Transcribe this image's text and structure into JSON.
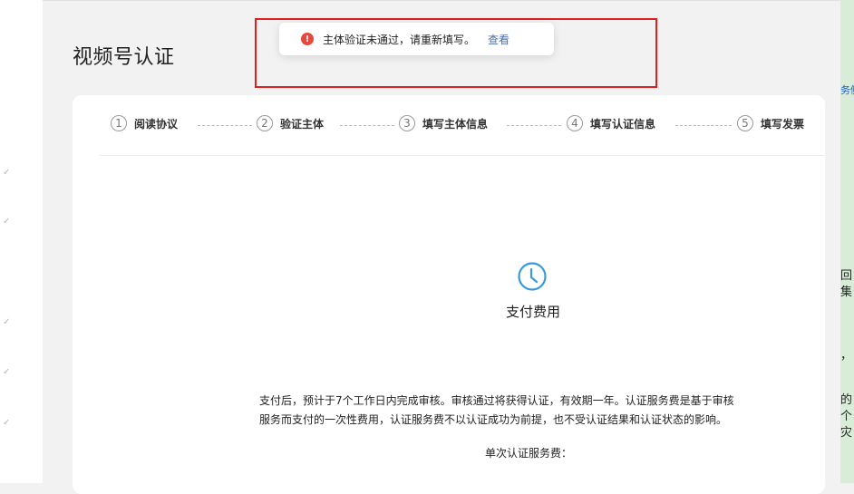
{
  "page": {
    "title": "视频号认证"
  },
  "steps": [
    {
      "number": "1",
      "label": "阅读协议"
    },
    {
      "number": "2",
      "label": "验证主体"
    },
    {
      "number": "3",
      "label": "填写主体信息"
    },
    {
      "number": "4",
      "label": "填写认证信息"
    },
    {
      "number": "5",
      "label": "填写发票"
    }
  ],
  "payment": {
    "icon": "clock-icon",
    "title": "支付费用",
    "description_line1": "支付后，预计于7个工作日内完成审核。审核通过将获得认证，有效期一年。认证服务费是基于审核",
    "description_line2": "服务而支付的一次性费用，认证服务费不以认证成功为前提，也不受认证结果和认证状态的影响。",
    "fee_label": "单次认证服务费："
  },
  "toast": {
    "icon": "error-icon",
    "message": "主体验证未通过，请重新填写。",
    "link": "查看"
  },
  "right_strip": {
    "link_fragment": "务侧",
    "frag1": "回",
    "frag2": "集",
    "frag3": "，",
    "frag4": "的",
    "frag5": "个",
    "frag6": "灾"
  },
  "colors": {
    "accent": "#3a9ad9",
    "error": "#e5483c",
    "link": "#4c6ea8",
    "highlight_box": "#e02020"
  }
}
